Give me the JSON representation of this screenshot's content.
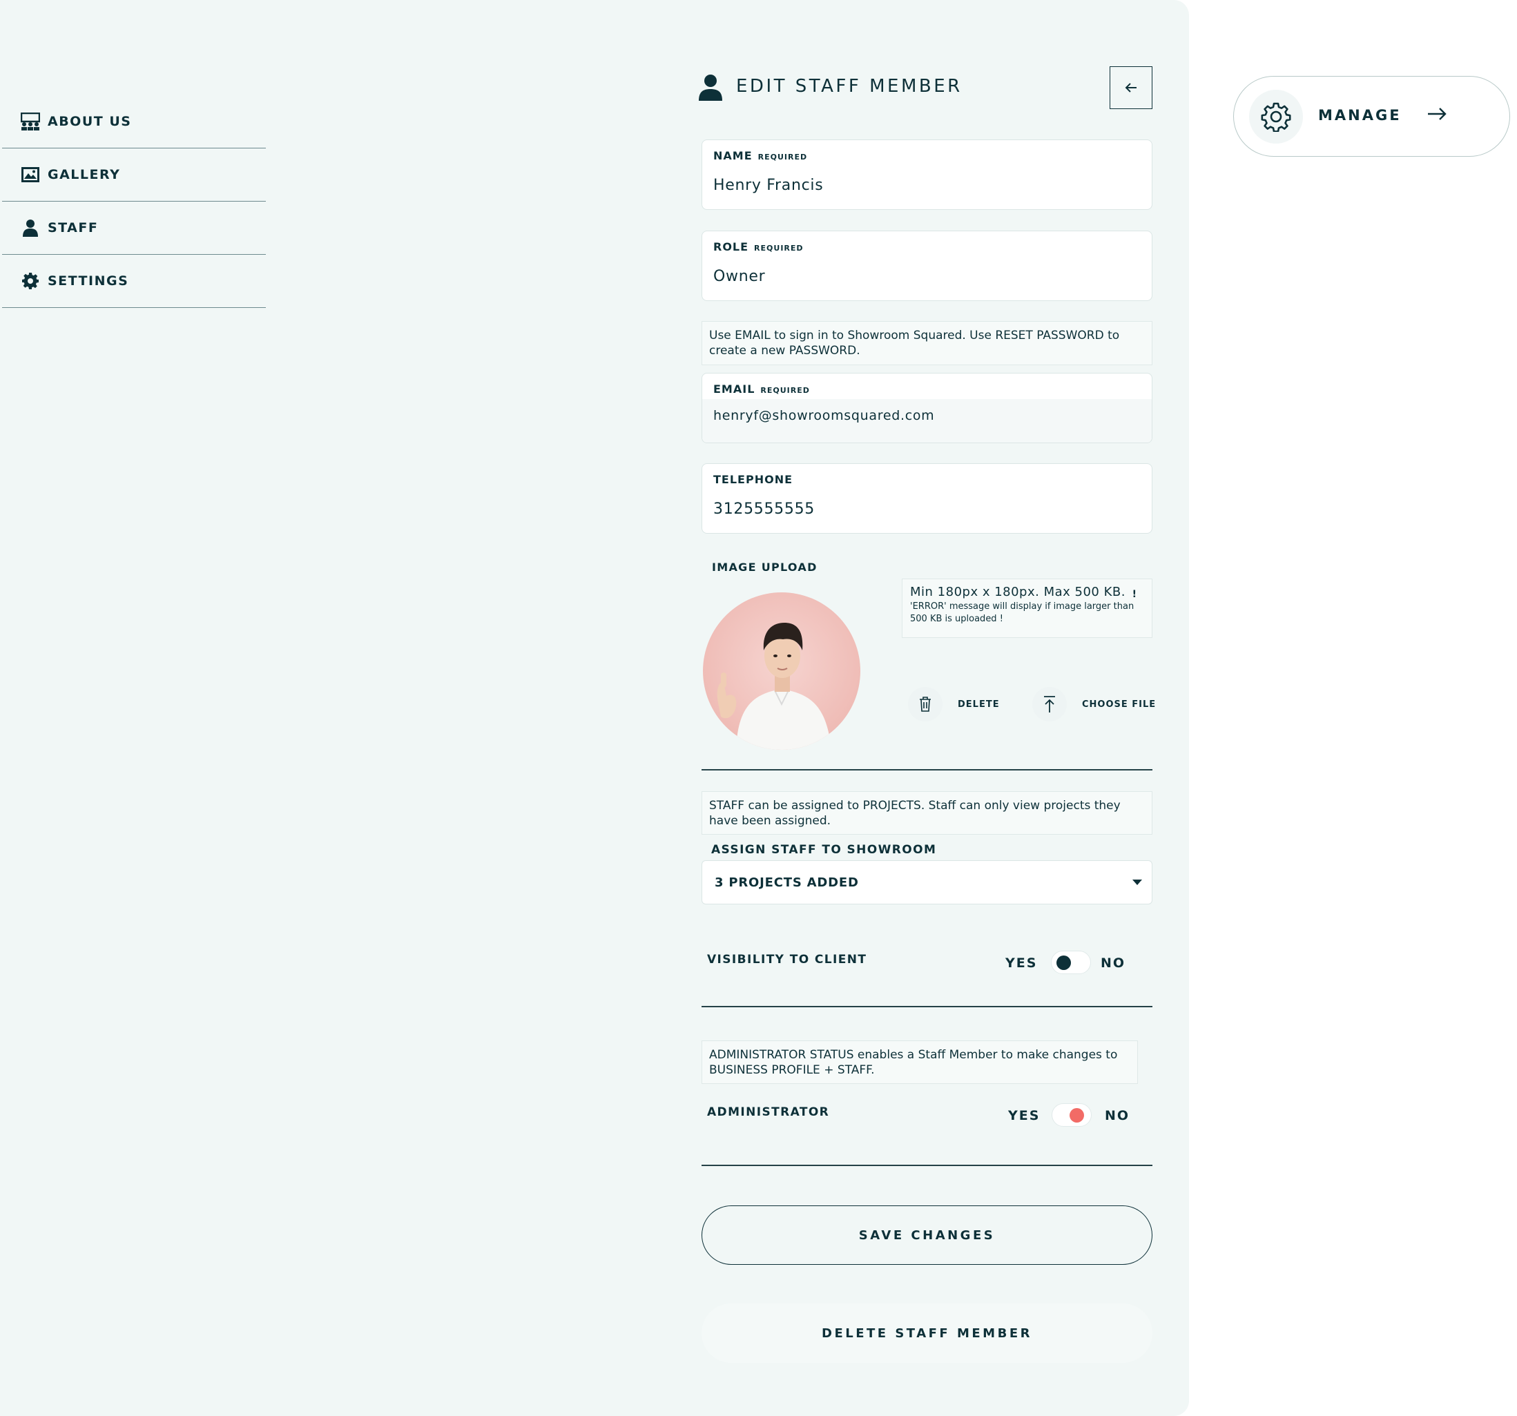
{
  "sidebar": {
    "items": [
      {
        "label": "ABOUT US",
        "icon": "team-icon"
      },
      {
        "label": "GALLERY",
        "icon": "image-icon"
      },
      {
        "label": "STAFF",
        "icon": "person-icon"
      },
      {
        "label": "SETTINGS",
        "icon": "gear-icon"
      }
    ]
  },
  "header": {
    "title": "EDIT STAFF MEMBER",
    "icon": "person-icon",
    "back_icon": "arrow-left-icon"
  },
  "form": {
    "name": {
      "label": "NAME",
      "required": "REQUIRED",
      "value": "Henry Francis"
    },
    "role": {
      "label": "ROLE",
      "required": "REQUIRED",
      "value": "Owner"
    },
    "email_note": "Use EMAIL to sign in to Showroom Squared. Use RESET PASSWORD to create a new PASSWORD.",
    "email": {
      "label": "EMAIL",
      "required": "REQUIRED",
      "value": "henryf@showroomsquared.com"
    },
    "telephone": {
      "label": "TELEPHONE",
      "value": "3125555555"
    },
    "image_upload": {
      "label": "IMAGE UPLOAD",
      "note_main": "Min 180px x 180px. Max 500 KB.",
      "note_mark": "!",
      "note_small": "'ERROR' message will display if image larger than 500 KB is uploaded !",
      "delete_label": "DELETE",
      "choose_label": "CHOOSE FILE"
    },
    "projects_note": "STAFF can be assigned to PROJECTS. Staff can only view projects they have been assigned.",
    "assign": {
      "label": "ASSIGN STAFF TO SHOWROOM",
      "selected": "3 PROJECTS ADDED"
    },
    "visibility": {
      "label": "VISIBILITY TO CLIENT",
      "yes": "YES",
      "no": "NO",
      "state": "YES"
    },
    "admin_note": "ADMINISTRATOR STATUS enables a Staff Member to make changes to BUSINESS PROFILE + STAFF.",
    "administrator": {
      "label": "ADMINISTRATOR",
      "yes": "YES",
      "no": "NO",
      "state": "YES"
    },
    "save_label": "SAVE CHANGES",
    "delete_label": "DELETE STAFF MEMBER"
  },
  "manage": {
    "label": "MANAGE",
    "icon": "gear-icon",
    "arrow_icon": "arrow-right-icon"
  },
  "colors": {
    "primary": "#0d3038",
    "panel_bg": "#f1f7f6",
    "toggle_on": "#0d3038",
    "toggle_alert": "#f26b66"
  }
}
